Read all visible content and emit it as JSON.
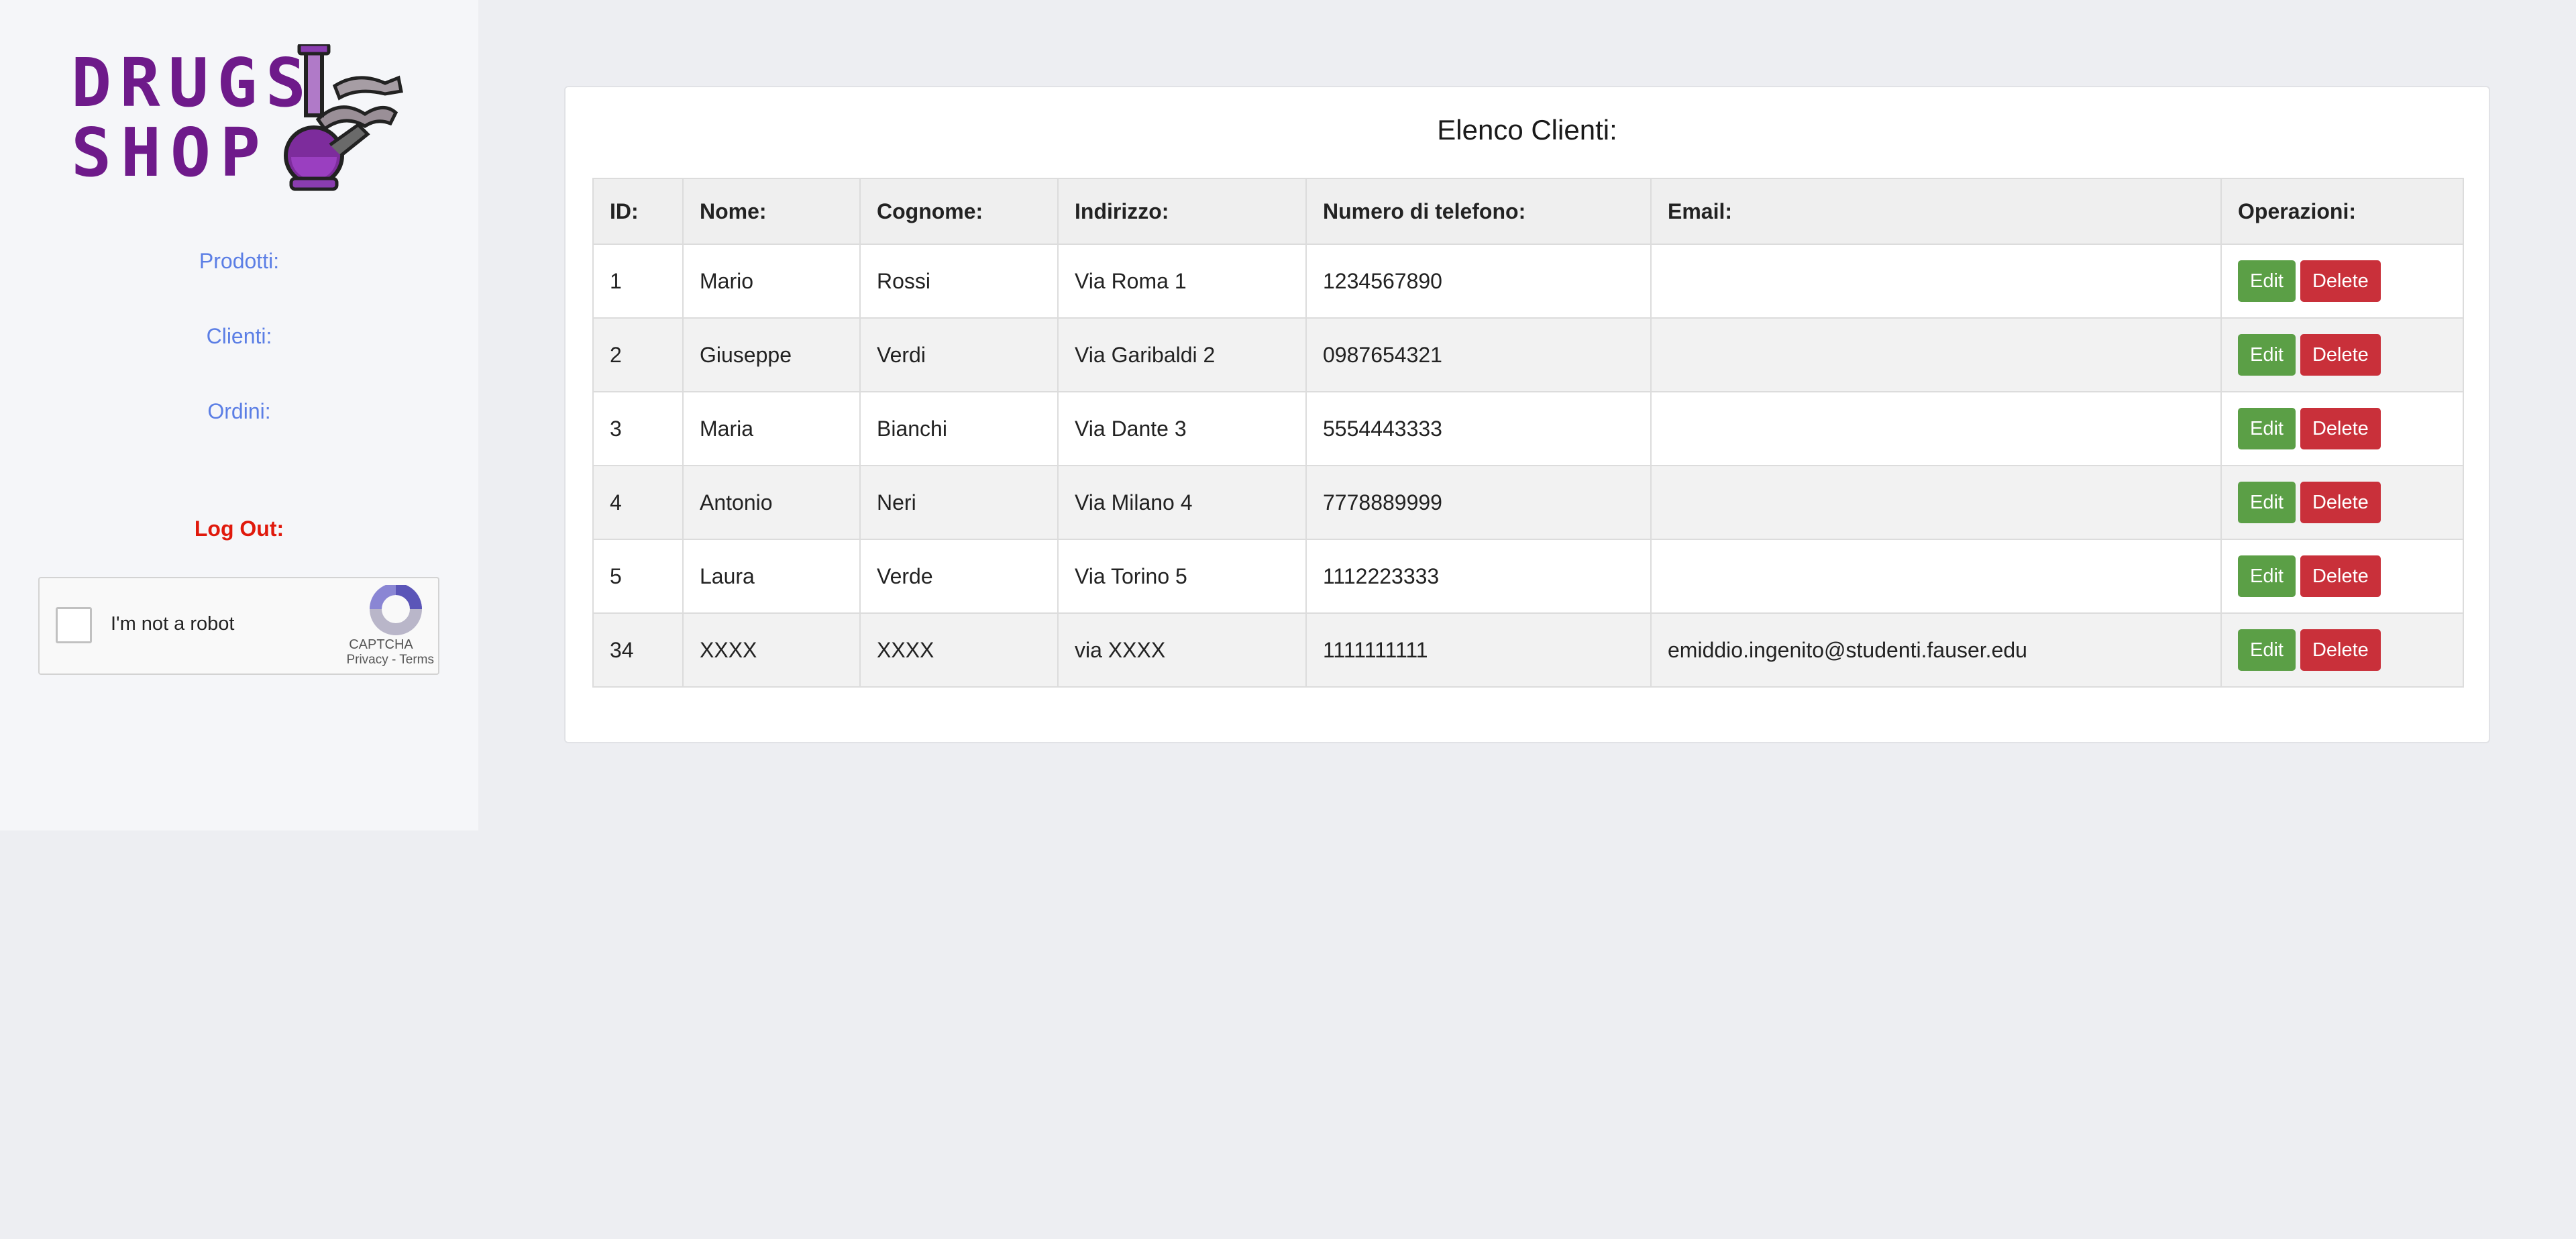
{
  "sidebar": {
    "logo_text_line1": "DRUGS",
    "logo_text_line2": "SHOP",
    "nav": [
      {
        "label": "Prodotti:"
      },
      {
        "label": "Clienti:"
      },
      {
        "label": "Ordini:"
      }
    ],
    "logout_label": "Log Out:",
    "captcha": {
      "label": "I'm not a robot",
      "brand": "CAPTCHA",
      "terms": "Privacy - Terms"
    }
  },
  "main": {
    "title": "Elenco Clienti:",
    "columns": [
      "ID:",
      "Nome:",
      "Cognome:",
      "Indirizzo:",
      "Numero di telefono:",
      "Email:",
      "Operazioni:"
    ],
    "rows": [
      {
        "id": "1",
        "nome": "Mario",
        "cognome": "Rossi",
        "indirizzo": "Via Roma 1",
        "telefono": "1234567890",
        "email": ""
      },
      {
        "id": "2",
        "nome": "Giuseppe",
        "cognome": "Verdi",
        "indirizzo": "Via Garibaldi 2",
        "telefono": "0987654321",
        "email": ""
      },
      {
        "id": "3",
        "nome": "Maria",
        "cognome": "Bianchi",
        "indirizzo": "Via Dante 3",
        "telefono": "5554443333",
        "email": ""
      },
      {
        "id": "4",
        "nome": "Antonio",
        "cognome": "Neri",
        "indirizzo": "Via Milano 4",
        "telefono": "7778889999",
        "email": ""
      },
      {
        "id": "5",
        "nome": "Laura",
        "cognome": "Verde",
        "indirizzo": "Via Torino 5",
        "telefono": "1112223333",
        "email": ""
      },
      {
        "id": "34",
        "nome": "XXXX",
        "cognome": "XXXX",
        "indirizzo": "via XXXX",
        "telefono": "1111111111",
        "email": "emiddio.ingenito@studenti.fauser.edu"
      }
    ],
    "edit_label": "Edit",
    "delete_label": "Delete"
  },
  "colors": {
    "nav_link": "#5b7ee5",
    "logout": "#e0190c",
    "edit_button": "#5b9f46",
    "delete_button": "#c9303a",
    "logo_purple": "#6e1a8a"
  }
}
